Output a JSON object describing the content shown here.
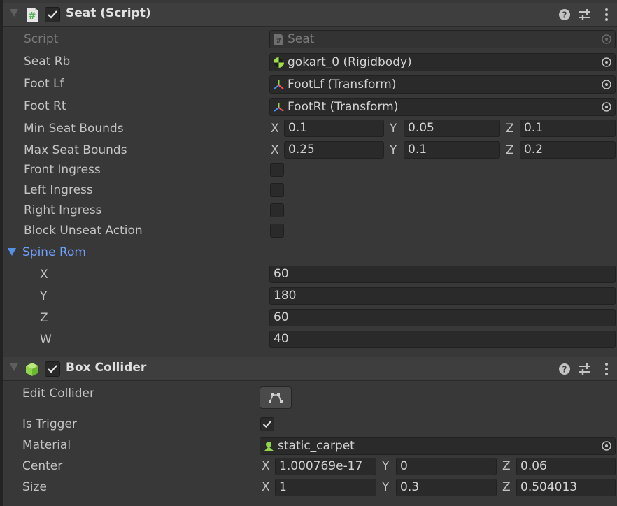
{
  "seat_component": {
    "title": "Seat (Script)",
    "enabled": true,
    "script": {
      "label": "Script",
      "value": "Seat"
    },
    "seat_rb": {
      "label": "Seat Rb",
      "value": "gokart_0 (Rigidbody)"
    },
    "foot_lf": {
      "label": "Foot Lf",
      "value": "FootLf (Transform)"
    },
    "foot_rt": {
      "label": "Foot Rt",
      "value": "FootRt (Transform)"
    },
    "min_seat_bounds": {
      "label": "Min Seat Bounds",
      "x": "0.1",
      "y": "0.05",
      "z": "0.1"
    },
    "max_seat_bounds": {
      "label": "Max Seat Bounds",
      "x": "0.25",
      "y": "0.1",
      "z": "0.2"
    },
    "front_ingress": {
      "label": "Front Ingress",
      "checked": false
    },
    "left_ingress": {
      "label": "Left Ingress",
      "checked": false
    },
    "right_ingress": {
      "label": "Right Ingress",
      "checked": false
    },
    "block_unseat_action": {
      "label": "Block Unseat Action",
      "checked": false
    },
    "spine_rom": {
      "label": "Spine Rom",
      "expanded": true,
      "x": {
        "label": "X",
        "value": "60"
      },
      "y": {
        "label": "Y",
        "value": "180"
      },
      "z": {
        "label": "Z",
        "value": "60"
      },
      "w": {
        "label": "W",
        "value": "40"
      }
    }
  },
  "box_collider": {
    "title": "Box Collider",
    "enabled": true,
    "edit_collider": {
      "label": "Edit Collider"
    },
    "is_trigger": {
      "label": "Is Trigger",
      "checked": true
    },
    "material": {
      "label": "Material",
      "value": "static_carpet"
    },
    "center": {
      "label": "Center",
      "x": "1.000769e-17",
      "y": "0",
      "z": "0.06"
    },
    "size": {
      "label": "Size",
      "x": "1",
      "y": "0.3",
      "z": "0.504013"
    }
  },
  "axis_labels": {
    "x": "X",
    "y": "Y",
    "z": "Z"
  },
  "icons": {
    "script": "script-hash-icon",
    "checkmark": "checkmark-icon",
    "help": "help-icon",
    "presets": "presets-sliders-icon",
    "menu": "more-vertical-icon",
    "object_picker": "object-picker-icon",
    "rigidbody": "rigidbody-icon",
    "transform": "transform-icon",
    "box_collider": "box-collider-cube-icon",
    "material": "physic-material-icon",
    "edit_collider": "edit-collider-icon"
  },
  "colors": {
    "background": "#383838",
    "header": "#3e3e3e",
    "field": "#2a2a2a",
    "link_blue": "#6ea2ff",
    "script_icon_green": "#4caf50",
    "cube_green": "#8fd44b"
  }
}
